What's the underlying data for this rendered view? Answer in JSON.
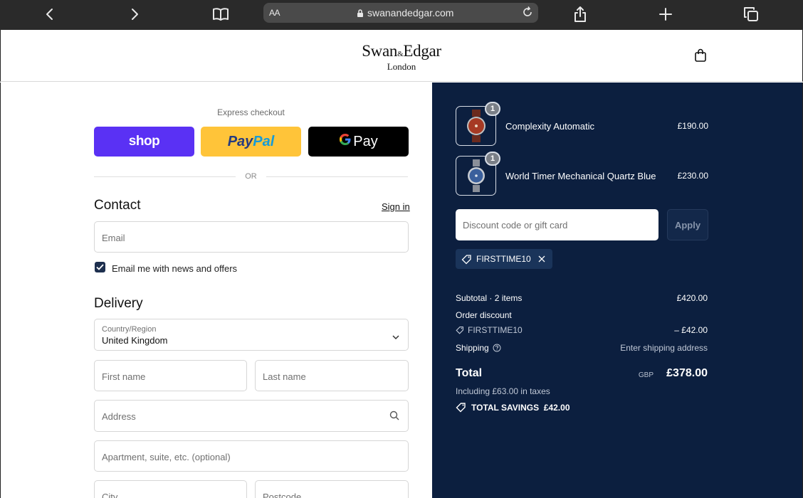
{
  "browser": {
    "text_size_label": "AA",
    "url": "swanandedgar.com"
  },
  "store": {
    "logo_main": "Swan",
    "logo_amp": "&",
    "logo_main2": "Edgar",
    "logo_sub": "London"
  },
  "checkout": {
    "express_label": "Express checkout",
    "shop_label": "shop",
    "paypal_label_1": "Pay",
    "paypal_label_2": "Pal",
    "gpay_label": "Pay",
    "or_label": "OR",
    "contact_title": "Contact",
    "signin_label": "Sign in",
    "email_placeholder": "Email",
    "newsletter_label": "Email me with news and offers",
    "newsletter_checked": true,
    "delivery_title": "Delivery",
    "country_label": "Country/Region",
    "country_value": "United Kingdom",
    "first_name_placeholder": "First name",
    "last_name_placeholder": "Last name",
    "address_placeholder": "Address",
    "apartment_placeholder": "Apartment, suite, etc. (optional)",
    "city_placeholder": "City",
    "postcode_placeholder": "Postcode"
  },
  "summary": {
    "items": [
      {
        "qty": "1",
        "name": "Complexity Automatic",
        "price": "£190.00"
      },
      {
        "qty": "1",
        "name": "World Timer Mechanical Quartz Blue",
        "price": "£230.00"
      }
    ],
    "discount_placeholder": "Discount code or gift card",
    "apply_label": "Apply",
    "applied_code": "FIRSTTIME10",
    "subtotal_label": "Subtotal · 2 items",
    "subtotal_value": "£420.00",
    "order_discount_label": "Order discount",
    "discount_code": "FIRSTTIME10",
    "discount_value": "– £42.00",
    "shipping_label": "Shipping",
    "shipping_value": "Enter shipping address",
    "total_label": "Total",
    "total_currency": "GBP",
    "total_value": "£378.00",
    "tax_text": "Including £63.00 in taxes",
    "savings_text": "TOTAL SAVINGS  £42.00"
  },
  "colors": {
    "shop_purple": "#5a31f4",
    "paypal_yellow": "#ffc439",
    "summary_navy": "#0c1f3f"
  }
}
